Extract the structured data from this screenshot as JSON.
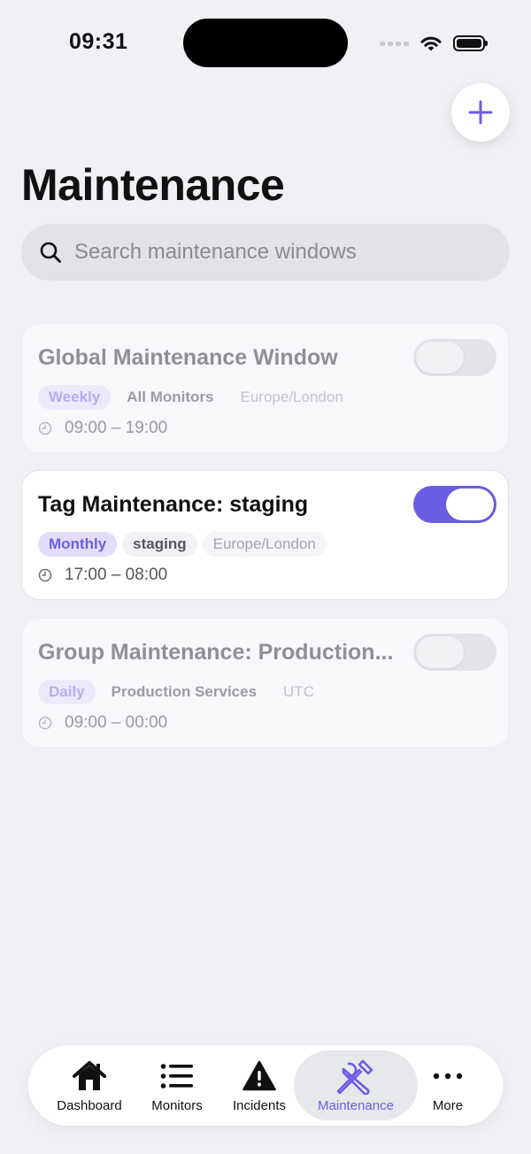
{
  "status_bar": {
    "time": "09:31"
  },
  "page": {
    "title": "Maintenance",
    "search_placeholder": "Search maintenance windows"
  },
  "windows": [
    {
      "title": "Global Maintenance Window",
      "enabled": false,
      "frequency": "Weekly",
      "scope": "All Monitors",
      "timezone": "Europe/London",
      "time_range": "09:00 – 19:00"
    },
    {
      "title": "Tag Maintenance: staging",
      "enabled": true,
      "frequency": "Monthly",
      "scope": "staging",
      "timezone": "Europe/London",
      "time_range": "17:00 – 08:00"
    },
    {
      "title": "Group Maintenance: Production...",
      "enabled": false,
      "frequency": "Daily",
      "scope": "Production Services",
      "timezone": "UTC",
      "time_range": "09:00 – 00:00"
    }
  ],
  "tabbar": {
    "active": "Maintenance",
    "items": [
      {
        "label": "Dashboard",
        "icon": "house-icon"
      },
      {
        "label": "Monitors",
        "icon": "list-icon"
      },
      {
        "label": "Incidents",
        "icon": "warning-icon"
      },
      {
        "label": "Maintenance",
        "icon": "wrench-screwdriver-icon"
      },
      {
        "label": "More",
        "icon": "ellipsis-icon"
      }
    ]
  },
  "colors": {
    "accent": "#6b5de5",
    "background": "#f0f1f5"
  }
}
